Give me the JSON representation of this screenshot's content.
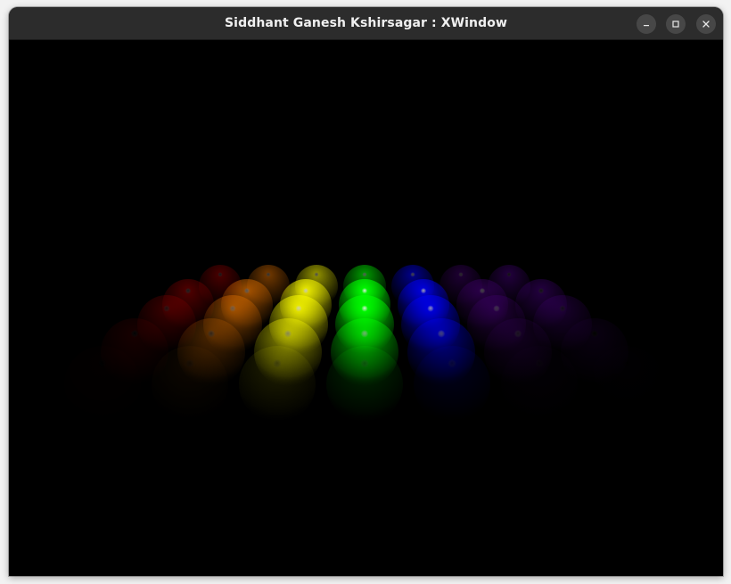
{
  "window": {
    "title": "Siddhant Ganesh Kshirsagar : XWindow"
  },
  "controls": {
    "minimize_icon": "minimize-icon",
    "maximize_icon": "maximize-icon",
    "close_icon": "close-icon"
  },
  "scene": {
    "background": "#000000",
    "sphere_colors": [
      "#ff0000",
      "#ff7f00",
      "#ffff00",
      "#00ff00",
      "#0000ff",
      "#4b0082",
      "#8b00ff"
    ]
  }
}
